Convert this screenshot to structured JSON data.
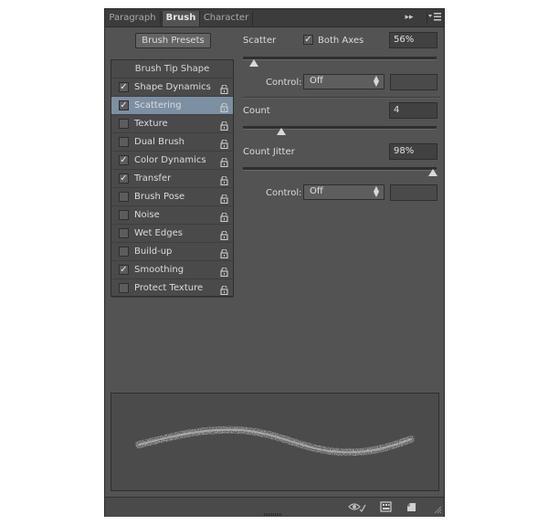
{
  "tabs": [
    "Paragraph",
    "Brush",
    "Character"
  ],
  "brush_presets_label": "Brush Presets",
  "list": {
    "header": "Brush Tip Shape",
    "items": [
      {
        "label": "Shape Dynamics",
        "checked": true,
        "selected": false
      },
      {
        "label": "Scattering",
        "checked": true,
        "selected": true
      },
      {
        "label": "Texture",
        "checked": false,
        "selected": false
      },
      {
        "label": "Dual Brush",
        "checked": false,
        "selected": false
      },
      {
        "label": "Color Dynamics",
        "checked": true,
        "selected": false
      },
      {
        "label": "Transfer",
        "checked": true,
        "selected": false
      },
      {
        "label": "Brush Pose",
        "checked": false,
        "selected": false
      },
      {
        "label": "Noise",
        "checked": false,
        "selected": false
      },
      {
        "label": "Wet Edges",
        "checked": false,
        "selected": false
      },
      {
        "label": "Build-up",
        "checked": false,
        "selected": false
      },
      {
        "label": "Smoothing",
        "checked": true,
        "selected": false
      },
      {
        "label": "Protect Texture",
        "checked": false,
        "selected": false
      }
    ]
  },
  "scatter": {
    "label": "Scatter",
    "both_axes_label": "Both Axes",
    "both_axes_checked": true,
    "value": "56%",
    "level": 0.056
  },
  "control1": {
    "label": "Control:",
    "value": "Off"
  },
  "count": {
    "label": "Count",
    "value": "4",
    "level": 0.2
  },
  "count_jitter": {
    "label": "Count Jitter",
    "value": "98%",
    "level": 0.98
  },
  "control2": {
    "label": "Control:",
    "value": "Off"
  },
  "icons": {
    "panel_menu": "panel-menu-icon",
    "collapse": "collapse-arrows-icon",
    "eye": "visibility-eye-icon",
    "grid": "brush-panel-grid-icon",
    "new": "new-preset-icon"
  },
  "colors": {
    "selected_row": "#7d8fa3",
    "panel_bg": "#535353"
  }
}
